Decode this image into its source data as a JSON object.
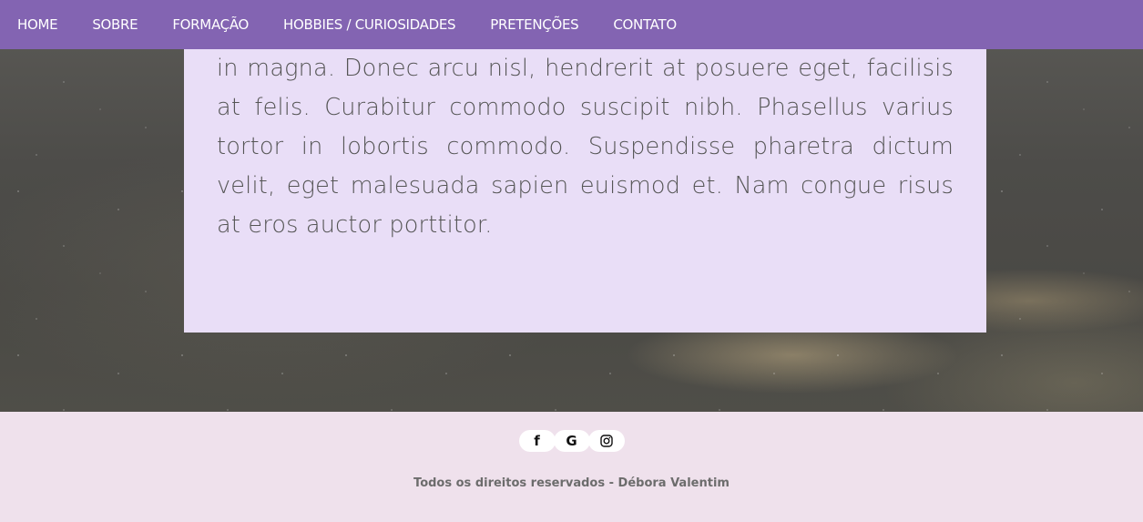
{
  "nav": {
    "items": [
      {
        "label": "HOME"
      },
      {
        "label": "SOBRE"
      },
      {
        "label": "FORMAÇÃO"
      },
      {
        "label": "HOBBIES / CURIOSIDADES"
      },
      {
        "label": "PRETENÇÕES"
      },
      {
        "label": "CONTATO"
      }
    ],
    "color": "#8364b2"
  },
  "content": {
    "text": "in magna. Donec arcu nisl, hendrerit at posuere eget, facilisis at felis. Curabitur commodo suscipit nibh. Phasellus varius tortor in lobortis commodo. Suspendisse pharetra dictum velit, eget malesuada sapien euismod et. Nam congue risus at eros auctor porttitor.",
    "background": "#e9def7"
  },
  "footer": {
    "social": [
      {
        "icon": "facebook-icon",
        "glyph": "f"
      },
      {
        "icon": "google-icon",
        "glyph": "G"
      },
      {
        "icon": "instagram-icon",
        "glyph": ""
      }
    ],
    "copyright": "Todos os direitos reservados - Débora Valentim",
    "background": "#efe1ec"
  }
}
